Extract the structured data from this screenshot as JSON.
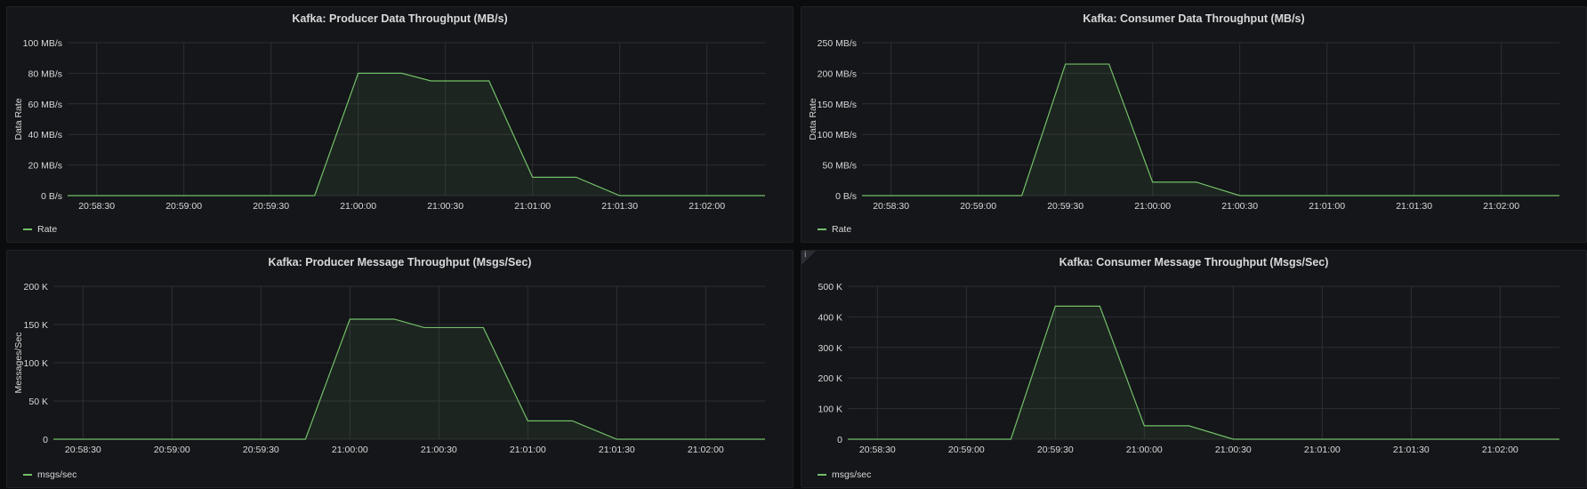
{
  "colors": {
    "series": "#73bf69",
    "grid": "#2c2e33",
    "panel_bg": "#141619",
    "page_bg": "#0b0c0e",
    "text": "#d8d9da"
  },
  "panels": [
    {
      "title": "Kafka: Producer Data Throughput (MB/s)",
      "legend": "Rate",
      "ylabel": "Data Rate",
      "info_icon": false
    },
    {
      "title": "Kafka: Consumer Data Throughput (MB/s)",
      "legend": "Rate",
      "ylabel": "Data Rate",
      "info_icon": false
    },
    {
      "title": "Kafka: Producer Message Throughput (Msgs/Sec)",
      "legend": "msgs/sec",
      "ylabel": "Messages/Sec",
      "info_icon": false
    },
    {
      "title": "Kafka: Consumer Message Throughput (Msgs/Sec)",
      "legend": "msgs/sec",
      "ylabel": "",
      "info_icon": true,
      "info_glyph": "i"
    }
  ],
  "chart_data": [
    {
      "type": "area",
      "title": "Kafka: Producer Data Throughput (MB/s)",
      "ylabel": "Data Rate",
      "x_ticks": [
        "20:58:30",
        "20:59:00",
        "20:59:30",
        "21:00:00",
        "21:00:30",
        "21:01:00",
        "21:01:30",
        "21:02:00"
      ],
      "y_ticks": [
        "0 B/s",
        "20 MB/s",
        "40 MB/s",
        "60 MB/s",
        "80 MB/s",
        "100 MB/s"
      ],
      "xlim": [
        "20:58:20",
        "20:59:30",
        "21:02:20"
      ],
      "ylim": [
        0,
        100
      ],
      "unit": "MB/s",
      "grid": true,
      "legend_position": "bottom-left",
      "series": [
        {
          "name": "Rate",
          "x": [
            "20:58:20",
            "20:59:45",
            "21:00:00",
            "21:00:15",
            "21:00:25",
            "21:00:45",
            "21:01:00",
            "21:01:15",
            "21:01:30",
            "21:02:20"
          ],
          "values": [
            0,
            0,
            80,
            80,
            75,
            75,
            12,
            12,
            0,
            0
          ]
        }
      ]
    },
    {
      "type": "area",
      "title": "Kafka: Consumer Data Throughput (MB/s)",
      "ylabel": "Data Rate",
      "x_ticks": [
        "20:58:30",
        "20:59:00",
        "20:59:30",
        "21:00:00",
        "21:00:30",
        "21:01:00",
        "21:01:30",
        "21:02:00"
      ],
      "y_ticks": [
        "0 B/s",
        "50 MB/s",
        "100 MB/s",
        "150 MB/s",
        "200 MB/s",
        "250 MB/s"
      ],
      "ylim": [
        0,
        250
      ],
      "unit": "MB/s",
      "grid": true,
      "legend_position": "bottom-left",
      "series": [
        {
          "name": "Rate",
          "x": [
            "20:58:20",
            "20:59:15",
            "20:59:30",
            "20:59:45",
            "21:00:00",
            "21:00:15",
            "21:00:30",
            "21:02:20"
          ],
          "values": [
            0,
            0,
            215,
            215,
            22,
            22,
            0,
            0
          ]
        }
      ]
    },
    {
      "type": "area",
      "title": "Kafka: Producer Message Throughput (Msgs/Sec)",
      "ylabel": "Messages/Sec",
      "x_ticks": [
        "20:58:30",
        "20:59:00",
        "20:59:30",
        "21:00:00",
        "21:00:30",
        "21:01:00",
        "21:01:30",
        "21:02:00"
      ],
      "y_ticks": [
        "0",
        "50 K",
        "100 K",
        "150 K",
        "200 K"
      ],
      "ylim": [
        0,
        200000
      ],
      "grid": true,
      "legend_position": "bottom-left",
      "series": [
        {
          "name": "msgs/sec",
          "x": [
            "20:58:20",
            "20:59:45",
            "21:00:00",
            "21:00:15",
            "21:00:25",
            "21:00:45",
            "21:01:00",
            "21:01:15",
            "21:01:30",
            "21:02:20"
          ],
          "values": [
            0,
            0,
            157000,
            157000,
            146000,
            146000,
            24000,
            24000,
            0,
            0
          ]
        }
      ]
    },
    {
      "type": "area",
      "title": "Kafka: Consumer Message Throughput (Msgs/Sec)",
      "ylabel": "",
      "x_ticks": [
        "20:58:30",
        "20:59:00",
        "20:59:30",
        "21:00:00",
        "21:00:30",
        "21:01:00",
        "21:01:30",
        "21:02:00"
      ],
      "y_ticks": [
        "0",
        "100 K",
        "200 K",
        "300 K",
        "400 K",
        "500 K"
      ],
      "ylim": [
        0,
        500000
      ],
      "grid": true,
      "legend_position": "bottom-left",
      "series": [
        {
          "name": "msgs/sec",
          "x": [
            "20:58:20",
            "20:59:15",
            "20:59:30",
            "20:59:45",
            "21:00:00",
            "21:00:15",
            "21:00:30",
            "21:02:20"
          ],
          "values": [
            0,
            0,
            435000,
            435000,
            44000,
            44000,
            0,
            0
          ]
        }
      ]
    }
  ]
}
